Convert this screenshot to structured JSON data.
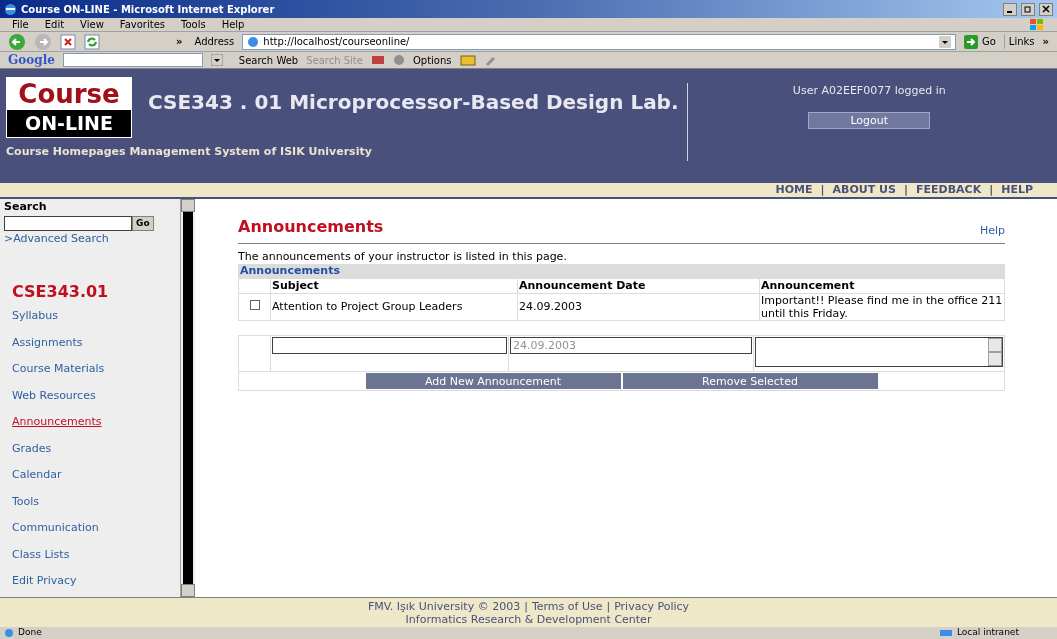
{
  "window": {
    "title": "Course ON-LINE - Microsoft Internet Explorer"
  },
  "menu": [
    "File",
    "Edit",
    "View",
    "Favorites",
    "Tools",
    "Help"
  ],
  "toolbar": {
    "chevron": "»",
    "address_label": "Address",
    "url": "http://localhost/courseonline/",
    "go": "Go",
    "links": "Links",
    "links_chevron": "»"
  },
  "google_bar": {
    "logo": "Google",
    "search_web": "Search Web",
    "search_site": "Search Site",
    "options": "Options"
  },
  "header": {
    "logo_top": "Course",
    "logo_bottom": "ON-LINE",
    "course_title": "CSE343 . 01 Microprocessor-Based Design Lab.",
    "tagline": "Course Homepages Management System of ISIK University",
    "user_text": "User A02EEF0077 logged in",
    "logout": "Logout"
  },
  "nav": {
    "separator": "|",
    "links": [
      "HOME",
      "ABOUT US",
      "FEEDBACK",
      "HELP"
    ]
  },
  "sidebar": {
    "search_label": "Search",
    "go": "Go",
    "advanced": ">Advanced Search",
    "course_code": "CSE343.01",
    "items": [
      {
        "label": "Syllabus",
        "selected": false
      },
      {
        "label": "Assignments",
        "selected": false
      },
      {
        "label": "Course Materials",
        "selected": false
      },
      {
        "label": "Web Resources",
        "selected": false
      },
      {
        "label": "Announcements",
        "selected": true
      },
      {
        "label": "Grades",
        "selected": false
      },
      {
        "label": "Calendar",
        "selected": false
      },
      {
        "label": "Tools",
        "selected": false
      },
      {
        "label": "Communication",
        "selected": false
      },
      {
        "label": "Class Lists",
        "selected": false
      },
      {
        "label": "Edit Privacy",
        "selected": false
      }
    ]
  },
  "main": {
    "title": "Announcements",
    "help": "Help",
    "intro": "The announcements of your instructor is listed in this page.",
    "table_caption": "Announcements",
    "columns": [
      "Subject",
      "Announcement Date",
      "Announcement"
    ],
    "rows": [
      {
        "checked": false,
        "subject": "Attention to Project Group Leaders",
        "date": "24.09.2003",
        "announcement": "Important!! Please find me in the office 211 until this Friday."
      }
    ],
    "new_form": {
      "date_value": "24.09.2003"
    },
    "buttons": [
      "Add New Announcement",
      "Remove Selected"
    ]
  },
  "footer": {
    "copyright": "FMV. Işık University © 2003",
    "separator": "|",
    "links": [
      "Terms of Use",
      "Privacy Policy"
    ],
    "line2": "Informatics Research & Development Center"
  },
  "status_bar": {
    "text": "Done",
    "zone": "Local intranet"
  }
}
